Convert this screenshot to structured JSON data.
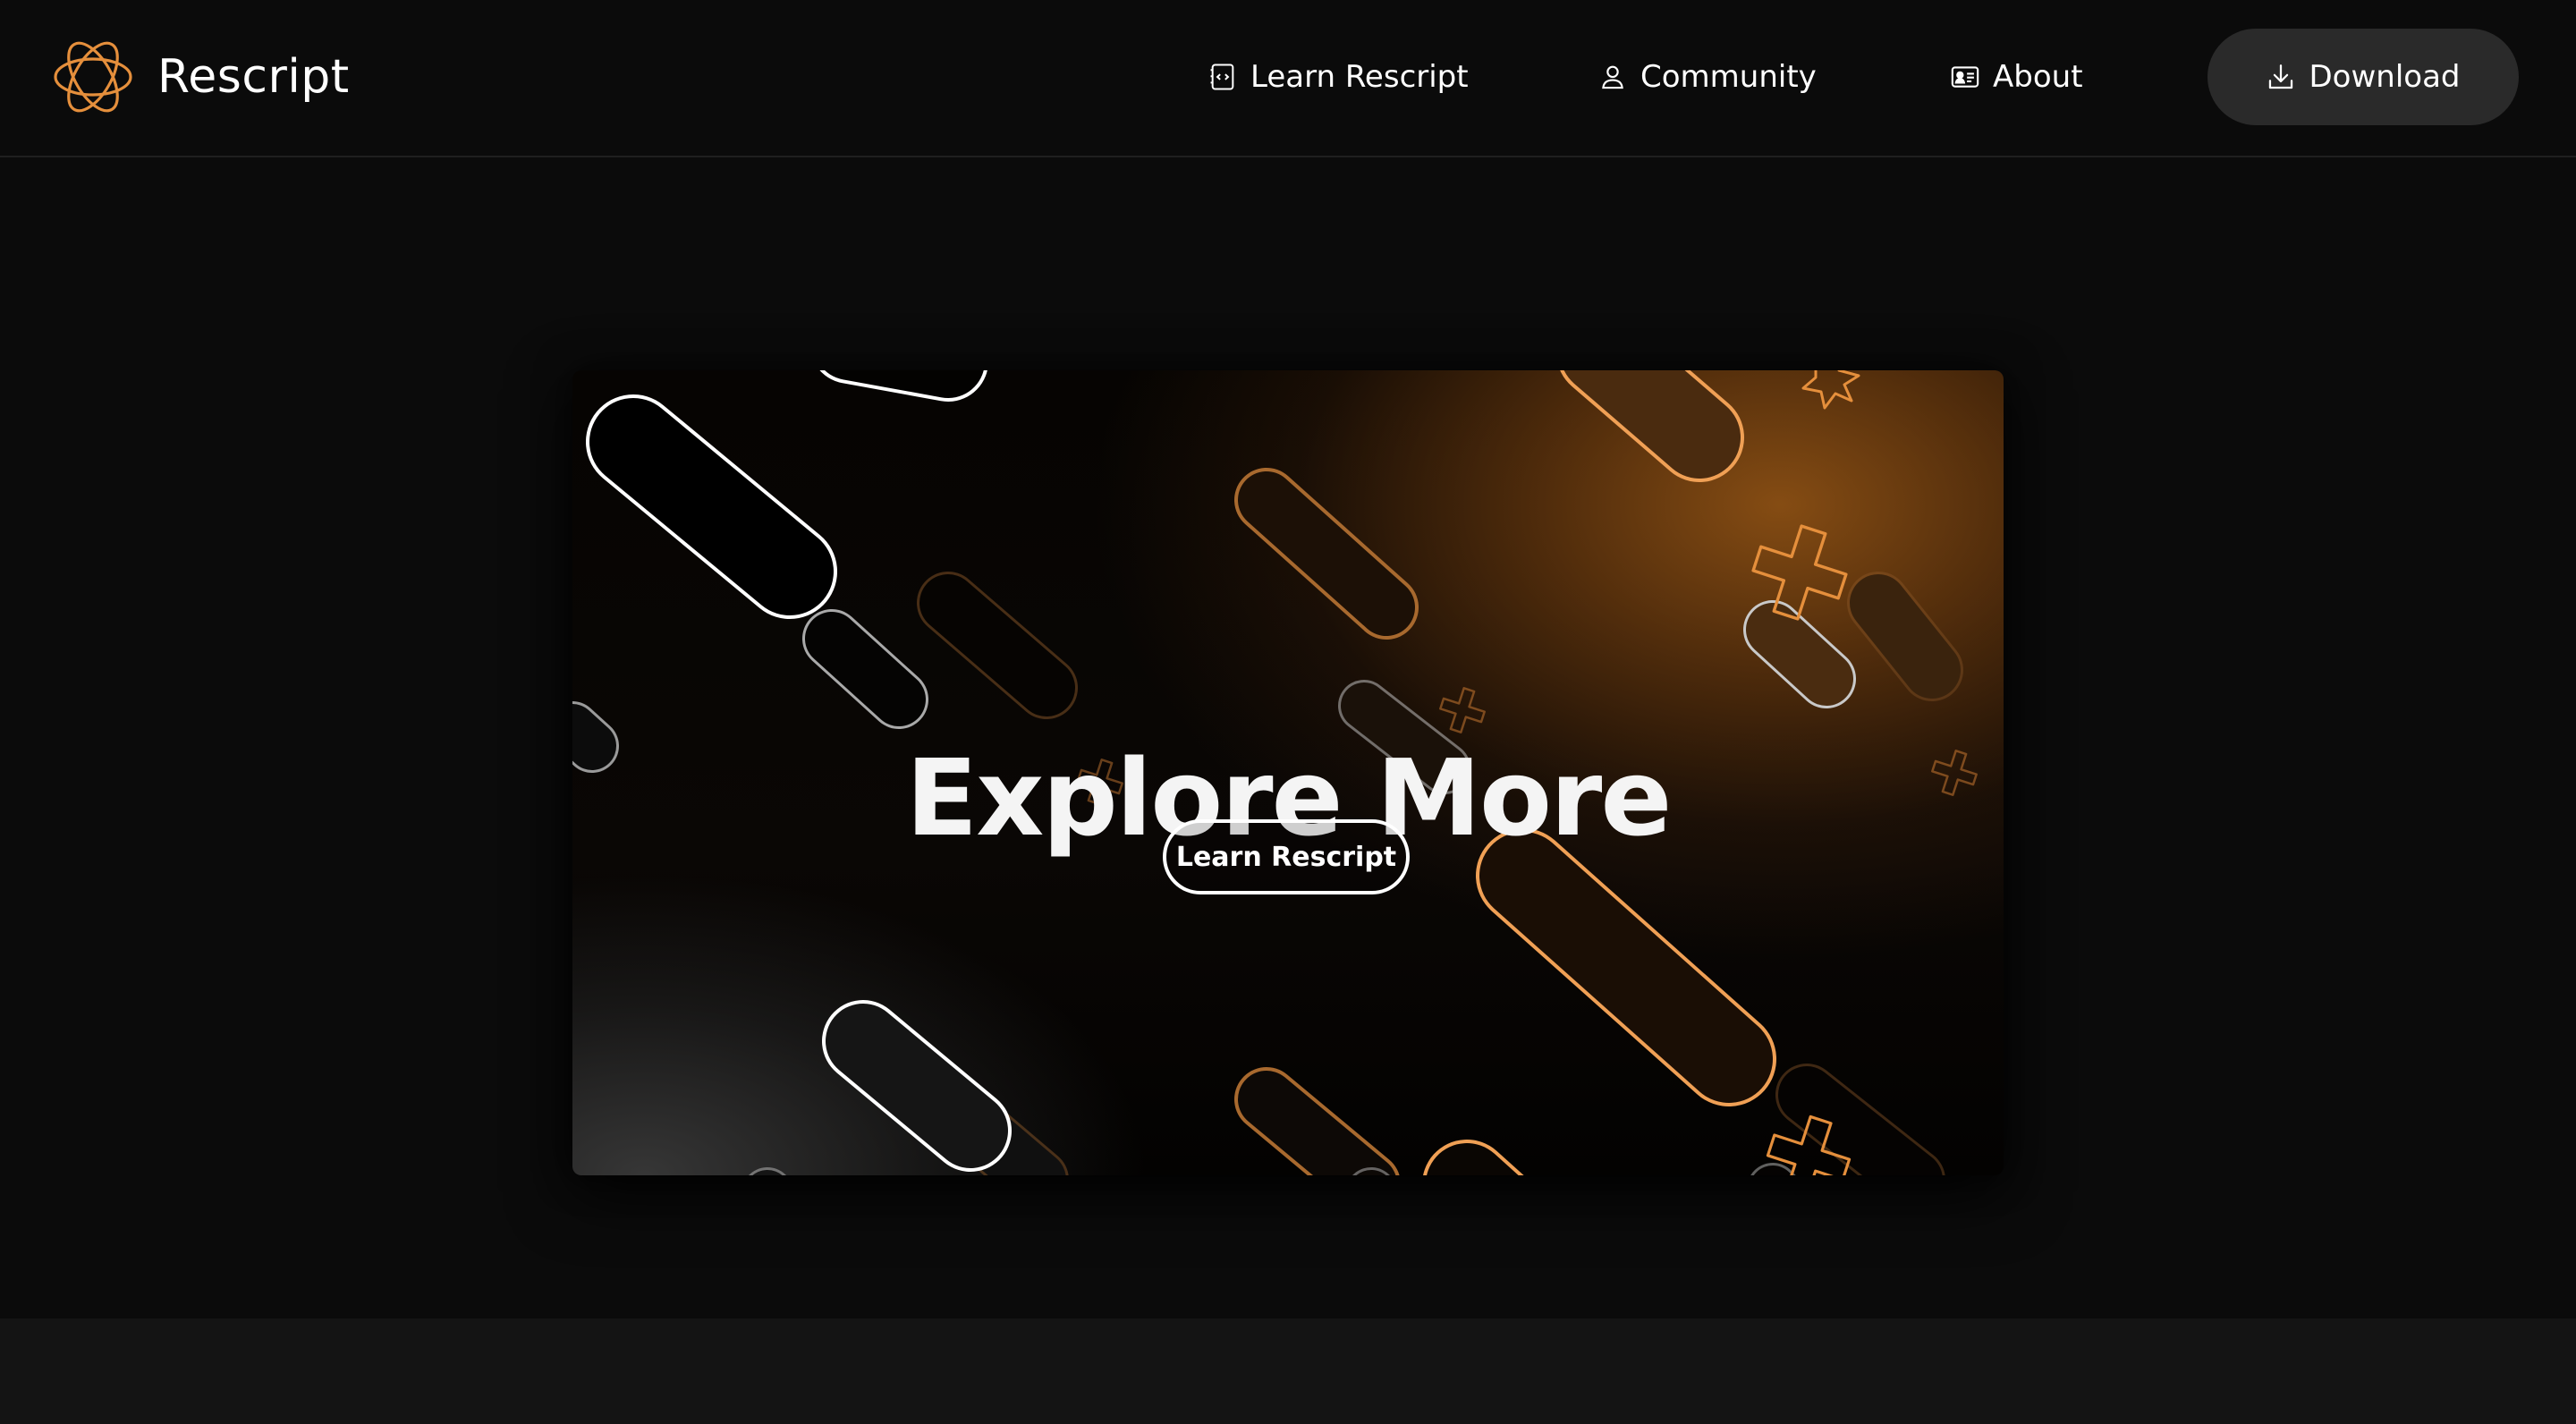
{
  "brand": {
    "name": "Rescript",
    "logo_icon": "atom-orbit-icon",
    "accent_color": "#e58f3c"
  },
  "nav": {
    "items": [
      {
        "label": "Learn Rescript",
        "icon": "code-file-icon"
      },
      {
        "label": "Community",
        "icon": "user-icon"
      },
      {
        "label": "About",
        "icon": "id-card-icon"
      }
    ],
    "download": {
      "label": "Download",
      "icon": "download-icon"
    }
  },
  "hero": {
    "title": "Explore More",
    "cta_label": "Learn Rescript"
  },
  "colors": {
    "background": "#0b0b0b",
    "header_border": "#1f1f1f",
    "download_bg": "#2a2a2a",
    "shape_orange": "#f0a055",
    "shape_white": "#ffffff"
  }
}
